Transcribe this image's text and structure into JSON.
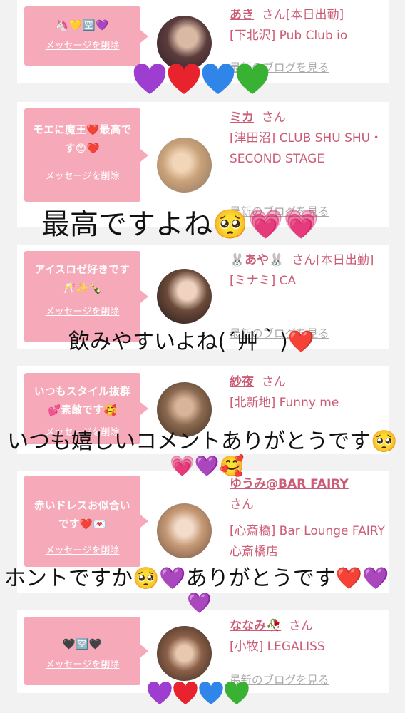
{
  "colors": {
    "bubble": "#f6a9b8",
    "accent": "#cc5c76",
    "muted": "#aaaaaa",
    "purple": "#9d3ed0",
    "red": "#e8232e",
    "blue": "#2f86e8",
    "green": "#39b233",
    "pink": "#ef5a9c"
  },
  "delete_label": "メッセージを削除",
  "blog_label": "最新のブログを見る",
  "cards": [
    {
      "message": "🦄💛🈳💜",
      "name": "あき",
      "status": "さん[本日出勤]",
      "shop": "[下北沢] Pub Club io"
    },
    {
      "message": "モエに魔王❤️最高です😊❤️",
      "name": "ミカ",
      "status": "さん",
      "shop": "[津田沼] CLUB SHU SHU・SECOND STAGE"
    },
    {
      "message": "アイスロゼ好きです🥂✨🍾",
      "name": "🐰あや🐰",
      "status": "さん[本日出勤]",
      "shop": "[ミナミ] CA"
    },
    {
      "message": "いつもスタイル抜群💕素敵です🥰",
      "name": "紗夜",
      "status": "さん",
      "shop": "[北新地] Funny me"
    },
    {
      "message": "赤いドレスお似合いです❤️💌",
      "name": "ゆうみ@BAR FAIRY",
      "status": "さん",
      "shop": "[心斎橋] Bar Lounge FAIRY 心斎橋店"
    },
    {
      "message": "🖤🈳🖤",
      "name": "ななみ🥀",
      "status": "さん",
      "shop": "[小牧] LEGALISS"
    }
  ],
  "overlays": {
    "text1": "最高ですよね🥺💗💗",
    "text2": "飲みやすいよね(´艸｀)❤️",
    "text3": "いつも嬉しいコメントありがとうです🥺",
    "text3b": "💗💜🥰",
    "text4": "ホントですか🥺💜ありがとうです❤️💜",
    "text4b": "💜"
  }
}
